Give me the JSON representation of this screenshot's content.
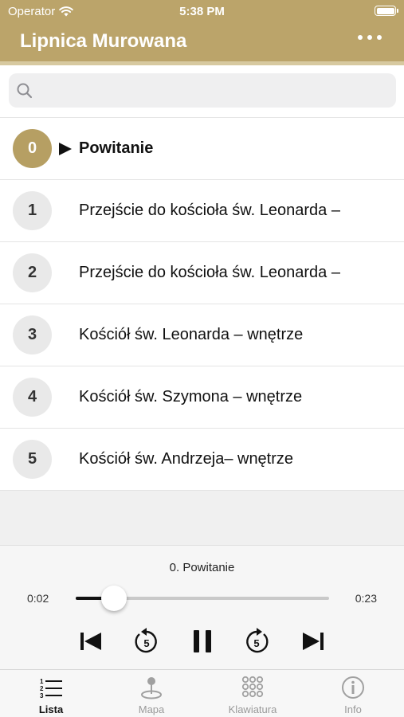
{
  "status_bar": {
    "carrier": "Operator",
    "time": "5:38 PM"
  },
  "header": {
    "title": "Lipnica Murowana"
  },
  "search": {
    "placeholder": ""
  },
  "list": {
    "items": [
      {
        "number": "0",
        "title": "Powitanie",
        "active": true
      },
      {
        "number": "1",
        "title": "Przejście do kościoła św. Leonarda –"
      },
      {
        "number": "2",
        "title": "Przejście do kościoła św. Leonarda –"
      },
      {
        "number": "3",
        "title": "Kościół św. Leonarda – wnętrze"
      },
      {
        "number": "4",
        "title": "Kościół św. Szymona – wnętrze"
      },
      {
        "number": "5",
        "title": "Kościół św. Andrzeja– wnętrze"
      }
    ]
  },
  "player": {
    "now_playing": "0. Powitanie",
    "elapsed": "0:02",
    "duration": "0:23",
    "progress": 0.15,
    "skip_back_seconds": "5",
    "skip_forward_seconds": "5"
  },
  "tabs": [
    {
      "label": "Lista",
      "icon": "list-icon",
      "selected": true
    },
    {
      "label": "Mapa",
      "icon": "map-pin-icon"
    },
    {
      "label": "Klawiatura",
      "icon": "keypad-icon"
    },
    {
      "label": "Info",
      "icon": "info-icon"
    }
  ],
  "colors": {
    "accent": "#bba46a",
    "active_badge": "#b69f63"
  }
}
